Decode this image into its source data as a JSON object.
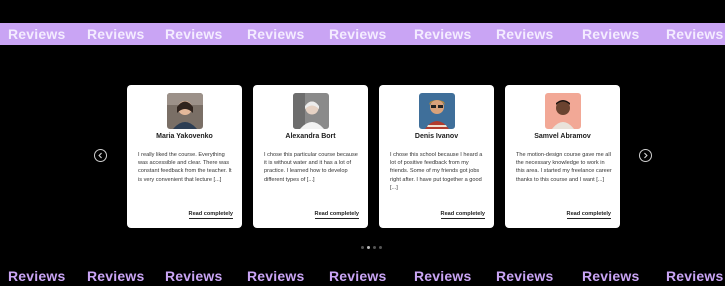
{
  "ticker": {
    "word": "Reviews",
    "count": 9
  },
  "nav": {
    "prev_icon": "chevron-left-icon",
    "next_icon": "chevron-right-icon"
  },
  "reviews": [
    {
      "name": "Maria Yakovenko",
      "text": "I really liked the course. Everything was accessible and clear. There was constant feedback from the teacher. It is very convenient that lecture [...]",
      "link": "Read completely"
    },
    {
      "name": "Alexandra Bort",
      "text": "I chose this particular course because it is without water and it has a lot of practice. I learned how to develop different types of [...]",
      "link": "Read completely"
    },
    {
      "name": "Denis Ivanov",
      "text": "I chose this school because I heard a lot of positive feedback from my friends. Some of my friends got jobs right after. I have put together a good [...]",
      "link": "Read completely"
    },
    {
      "name": "Samvel Abramov",
      "text": "The motion-design course gave me all the necessary knowledge to work in this area. I started my freelance career thanks to this course and I want [...]",
      "link": "Read completely"
    }
  ],
  "pagination": {
    "total": 4,
    "active": 1
  }
}
